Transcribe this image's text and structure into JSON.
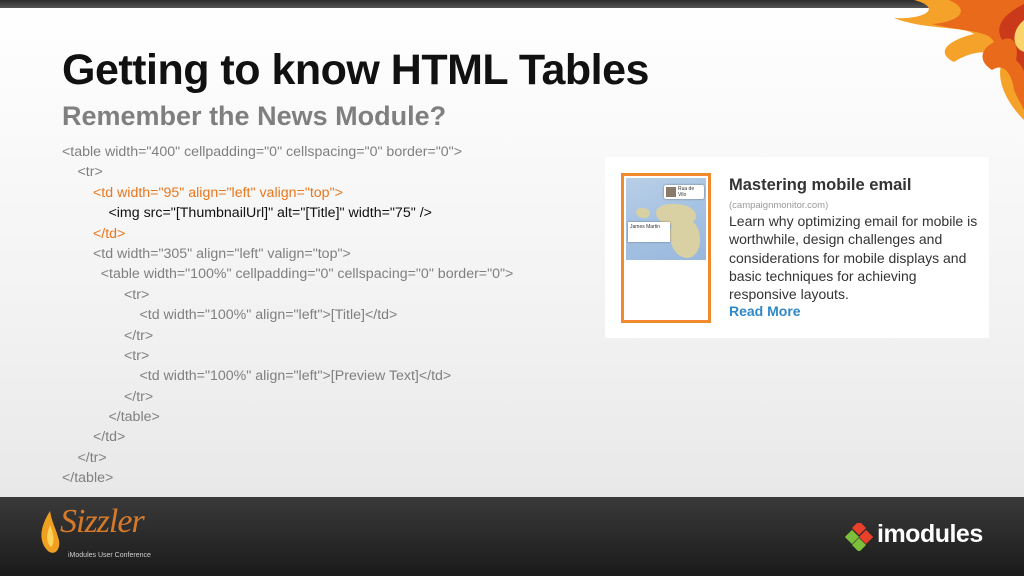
{
  "slide": {
    "title": "Getting to know HTML Tables",
    "subtitle": "Remember the News Module?"
  },
  "code_lines": [
    {
      "text": "<table width=\"400\" cellpadding=\"0\" cellspacing=\"0\" border=\"0\">",
      "indent": 0,
      "style": "gray"
    },
    {
      "text": "<tr>",
      "indent": 1,
      "style": "gray"
    },
    {
      "text": "<td width=\"95\" align=\"left\" valign=\"top\">",
      "indent": 2,
      "style": "orange"
    },
    {
      "text": "<img src=\"[ThumbnailUrl]\" alt=\"[Title]\" width=\"75\" />",
      "indent": 3,
      "style": "black"
    },
    {
      "text": "</td>",
      "indent": 2,
      "style": "orange"
    },
    {
      "text": "<td width=\"305\" align=\"left\" valign=\"top\">",
      "indent": 2,
      "style": "gray"
    },
    {
      "text": "<table width=\"100%\" cellpadding=\"0\" cellspacing=\"0\" border=\"0\">",
      "indent": 2.5,
      "style": "gray"
    },
    {
      "text": "<tr>",
      "indent": 4,
      "style": "gray"
    },
    {
      "text": "<td width=\"100%\" align=\"left\">[Title]</td>",
      "indent": 5,
      "style": "gray"
    },
    {
      "text": "</tr>",
      "indent": 4,
      "style": "gray"
    },
    {
      "text": "<tr>",
      "indent": 4,
      "style": "gray"
    },
    {
      "text": "<td width=\"100%\" align=\"left\">[Preview Text]</td>",
      "indent": 5,
      "style": "gray"
    },
    {
      "text": "</tr>",
      "indent": 4,
      "style": "gray"
    },
    {
      "text": "</table>",
      "indent": 3,
      "style": "gray"
    },
    {
      "text": "</td>",
      "indent": 2,
      "style": "gray"
    },
    {
      "text": "</tr>",
      "indent": 1,
      "style": "gray"
    },
    {
      "text": "</table>",
      "indent": 0,
      "style": "gray"
    }
  ],
  "news_card": {
    "title": "Mastering mobile email",
    "source": "(campaignmonitor.com)",
    "preview": "Learn why optimizing email for mobile is worthwhile, design challenges and considerations for mobile displays and basic techniques for achieving responsive layouts.",
    "read_more": "Read More",
    "thumbnail": {
      "tag_label": "Rua de Vilo",
      "name_label": "James Martin"
    }
  },
  "footer": {
    "left_logo_word": "Sizzler",
    "left_logo_sub": "iModules User Conference",
    "right_logo_word": "imodules"
  },
  "colors": {
    "accent_orange": "#e8771d",
    "link_blue": "#2f88c8",
    "code_gray": "#7f7f7f"
  }
}
